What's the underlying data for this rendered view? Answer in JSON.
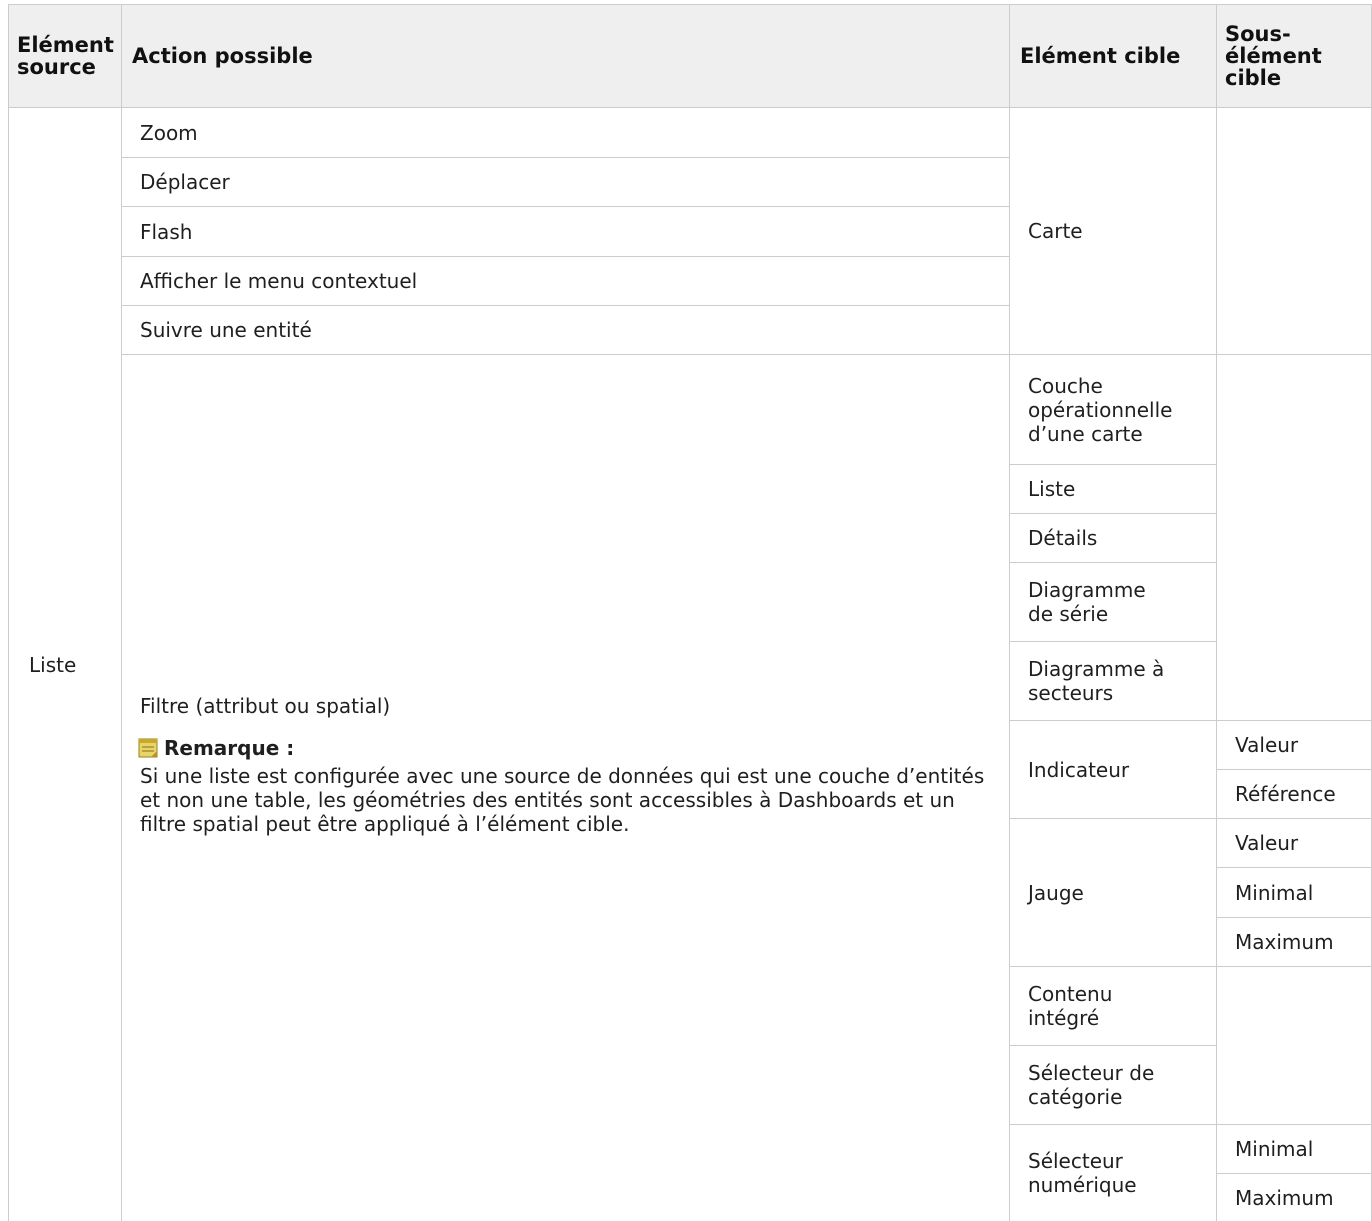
{
  "headers": {
    "source": "Elément source",
    "action": "Action possible",
    "target": "Elément cible",
    "subtarget": "Sous-élément cible"
  },
  "source_value": "Liste",
  "map_actions": [
    "Zoom",
    "Déplacer",
    "Flash",
    "Afficher le menu contextuel",
    "Suivre une entité"
  ],
  "map_target": "Carte",
  "filter_action": "Filtre (attribut ou spatial)",
  "note": {
    "title": "Remarque :",
    "text": "Si une liste est configurée avec une source de données qui est une couche d’entités et non une table, les géométries des entités sont accessibles à Dashboards et un filtre spatial peut être appliqué à l’élément cible."
  },
  "filter_targets": {
    "operational_layer": "Couche opérationnelle d’une carte",
    "list": "Liste",
    "details": "Détails",
    "serial_chart": "Diagramme de série",
    "pie_chart": "Diagramme à secteurs",
    "indicator": "Indicateur",
    "gauge": "Jauge",
    "embedded": "Contenu intégré",
    "category_selector": "Sélecteur de catégorie",
    "numeric_selector": "Sélecteur numérique"
  },
  "subtargets": {
    "indicator_value": "Valeur",
    "indicator_reference": "Référence",
    "gauge_value": "Valeur",
    "gauge_min": "Minimal",
    "gauge_max": "Maximum",
    "numeric_min": "Minimal",
    "numeric_max": "Maximum"
  },
  "colors": {
    "header_bg": "#efefef",
    "border": "#cccccc",
    "note_icon": "#c9b23a"
  }
}
